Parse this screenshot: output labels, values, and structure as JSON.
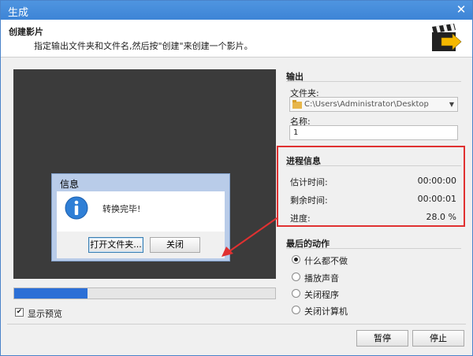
{
  "window": {
    "title": "生成",
    "close_glyph": "✕"
  },
  "header": {
    "title": "创建影片",
    "description": "指定输出文件夹和文件名,然后按\"创建\"来创建一个影片。",
    "icon": "clapperboard-arrow-icon"
  },
  "dialog": {
    "title": "信息",
    "icon": "info-icon",
    "message": "转换完毕!",
    "open_folder_label": "打开文件夹...",
    "close_label": "关闭"
  },
  "progress": {
    "percent": 28.0
  },
  "preview": {
    "show_label": "显示预览",
    "checked": true
  },
  "output": {
    "section_title": "输出",
    "folder_label": "文件夹:",
    "folder_value": "C:\\Users\\Administrator\\Desktop",
    "name_label": "名称:",
    "name_value": "1"
  },
  "progress_info": {
    "section_title": "进程信息",
    "estimated_label": "估计时间:",
    "estimated_value": "00:00:00",
    "remaining_label": "剩余时间:",
    "remaining_value": "00:00:01",
    "progress_label": "进度:",
    "progress_value": "28.0 %"
  },
  "final_action": {
    "section_title": "最后的动作",
    "options": [
      "什么都不做",
      "播放声音",
      "关闭程序",
      "关闭计算机"
    ],
    "selected": 0
  },
  "buttons": {
    "pause_label": "暂停",
    "stop_label": "停止"
  },
  "colors": {
    "titlebar": "#3d84d6",
    "progress_fill": "#2c6fd6",
    "highlight_box": "#e03131"
  }
}
